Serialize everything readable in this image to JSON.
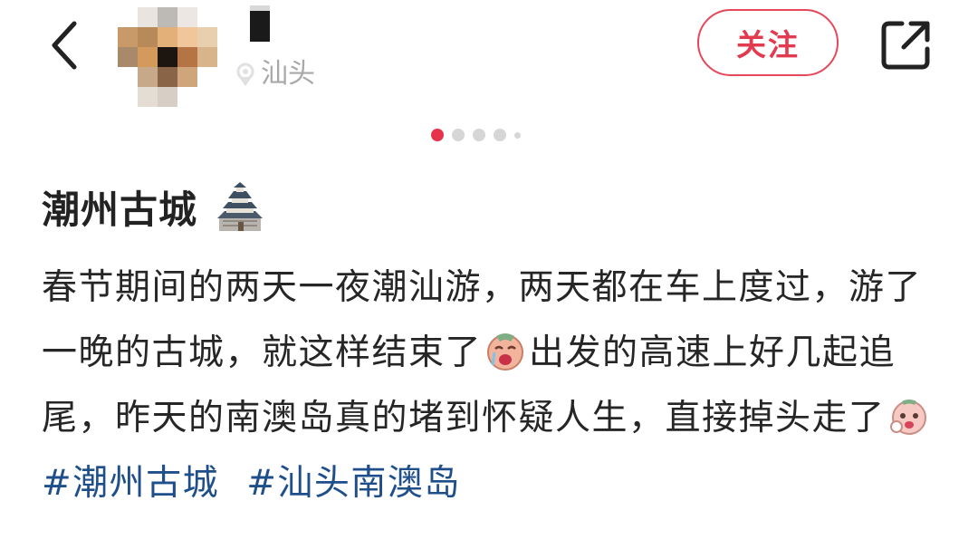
{
  "header": {
    "location": "汕头",
    "follow_label": "关注"
  },
  "carousel": {
    "total": 5,
    "active_index": 0
  },
  "post": {
    "title": "潮州古城",
    "body_part1": "春节期间的两天一夜潮汕游，两天都在车上度过，游了一晚的古城，就这样结束了",
    "body_part2": "出发的高速上好几起追尾，昨天的南澳岛真的堵到怀疑人生，直接掉头走了",
    "tags": [
      "#潮州古城",
      "#汕头南澳岛"
    ]
  },
  "icons": {
    "back": "back-arrow-icon",
    "share": "share-icon",
    "location": "location-pin-icon",
    "title_emoji": "castle-icon",
    "emoji_1": "crying-face-icon",
    "emoji_2": "sad-face-icon"
  },
  "colors": {
    "accent": "#e8324b",
    "tag": "#1f4f8a",
    "muted": "#a8a8a8"
  }
}
